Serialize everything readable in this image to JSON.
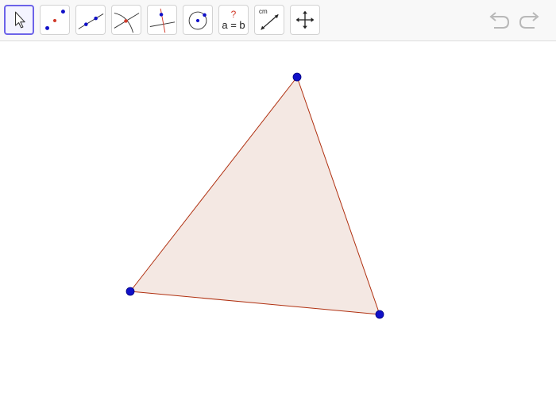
{
  "toolbar": {
    "tools": [
      {
        "name": "move",
        "selected": true
      },
      {
        "name": "point"
      },
      {
        "name": "line"
      },
      {
        "name": "intersect"
      },
      {
        "name": "perpendicular-line"
      },
      {
        "name": "circle"
      },
      {
        "name": "relation",
        "question_mark": "?",
        "equation": "a = b"
      },
      {
        "name": "distance",
        "unit_label": "cm"
      },
      {
        "name": "move-graphics-view"
      }
    ],
    "undo_icon": "undo-icon",
    "redo_icon": "redo-icon"
  },
  "construction": {
    "polygon": {
      "type": "triangle",
      "fill": "#f4e8e3",
      "stroke": "#b03010"
    },
    "point_color": "#1010c8"
  },
  "colors": {
    "selected_tool_border": "#6c63e8",
    "toolbar_background": "#f8f8f8",
    "point": "#1010c8",
    "polygon_edge": "#b03010",
    "polygon_fill": "#f4e8e3"
  }
}
